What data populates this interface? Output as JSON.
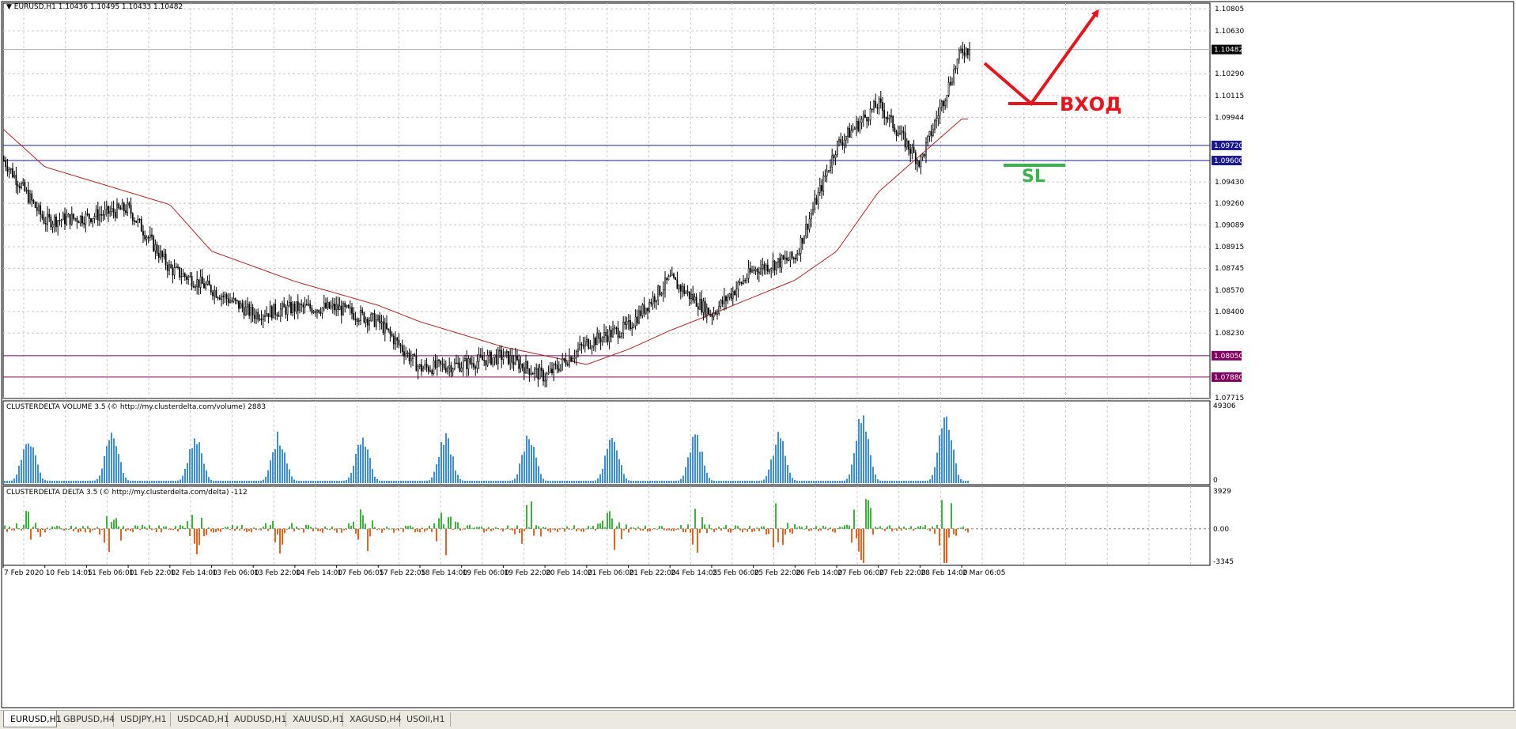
{
  "chart_header": {
    "caret": "▼",
    "title": "EURUSD,H1  1.10436 1.10495 1.10433 1.10482"
  },
  "indicators": {
    "volume_title": "CLUSTERDELTA VOLUME 3.5 (© http://my.clusterdelta.com/volume) 2883",
    "volume_axis": [
      "49306",
      "0"
    ],
    "delta_title": "CLUSTERDELTA DELTA 3.5 (© http://my.clusterdelta.com/delta) -112",
    "delta_axis": [
      "3929",
      "0.00",
      "-3345"
    ]
  },
  "price_axis": [
    "1.10805",
    "1.10630",
    "1.10290",
    "1.10115",
    "1.09944",
    "1.09430",
    "1.09260",
    "1.09089",
    "1.08915",
    "1.08745",
    "1.08570",
    "1.08400",
    "1.08230",
    "1.07715"
  ],
  "price_flags": [
    {
      "text": "1.10482",
      "color": "#000000"
    },
    {
      "text": "1.09720",
      "color": "#1a1a8c"
    },
    {
      "text": "1.09600",
      "color": "#1a1a8c"
    },
    {
      "text": "1.08050",
      "color": "#800060"
    },
    {
      "text": "1.07880",
      "color": "#800060"
    }
  ],
  "time_axis": [
    "7 Feb 2020",
    "10 Feb 14:05",
    "11 Feb 06:00",
    "11 Feb 22:00",
    "12 Feb 14:00",
    "13 Feb 06:00",
    "13 Feb 22:00",
    "14 Feb 14:00",
    "17 Feb 06:05",
    "17 Feb 22:05",
    "18 Feb 14:00",
    "19 Feb 06:00",
    "19 Feb 22:00",
    "20 Feb 14:00",
    "21 Feb 06:00",
    "21 Feb 22:00",
    "24 Feb 14:05",
    "25 Feb 06:00",
    "25 Feb 22:00",
    "26 Feb 14:00",
    "27 Feb 06:00",
    "27 Feb 22:00",
    "28 Feb 14:00",
    "2 Mar 06:05"
  ],
  "annotations": {
    "entry": "ВХОД",
    "stop_loss": "SL",
    "entry_color": "#e8141c",
    "sl_color": "#3ab34a"
  },
  "tabs": [
    {
      "label": "EURUSD,H1",
      "active": true
    },
    {
      "label": "GBPUSD,H4",
      "active": false
    },
    {
      "label": "USDJPY,H1",
      "active": false
    },
    {
      "label": "USDCAD,H1",
      "active": false
    },
    {
      "label": "AUDUSD,H1",
      "active": false
    },
    {
      "label": "XAUUSD,H1",
      "active": false
    },
    {
      "label": "XAGUSD,H4",
      "active": false
    },
    {
      "label": "USOil,H1",
      "active": false
    }
  ],
  "colors": {
    "candle": "#000000",
    "moving_average": "#b22222",
    "volume_bar": "#3a8fd8",
    "delta_positive": "#3cb43c",
    "delta_negative": "#e8641e",
    "level_blue": "#1a1a8c",
    "level_purple": "#800060"
  },
  "chart_data": {
    "type": "candlestick",
    "symbol": "EURUSD",
    "timeframe": "H1",
    "ylim": [
      1.0771,
      1.1085
    ],
    "last": {
      "open": 1.10436,
      "high": 1.10495,
      "low": 1.10433,
      "close": 1.10482
    },
    "levels": [
      1.0972,
      1.096,
      1.0805,
      1.0788
    ],
    "close_path": [
      {
        "x": "7 Feb 2020",
        "y": 1.0949
      },
      {
        "x": "7 Feb 2020",
        "y": 1.0961
      },
      {
        "x": "10 Feb 14:05",
        "y": 1.0912
      },
      {
        "x": "11 Feb 06:00",
        "y": 1.0915
      },
      {
        "x": "11 Feb 22:00",
        "y": 1.0922
      },
      {
        "x": "12 Feb 14:00",
        "y": 1.0874
      },
      {
        "x": "13 Feb 06:00",
        "y": 1.0858
      },
      {
        "x": "13 Feb 22:00",
        "y": 1.0838
      },
      {
        "x": "14 Feb 14:00",
        "y": 1.0843
      },
      {
        "x": "17 Feb 06:05",
        "y": 1.0843
      },
      {
        "x": "17 Feb 22:05",
        "y": 1.0832
      },
      {
        "x": "18 Feb 14:00",
        "y": 1.0795
      },
      {
        "x": "19 Feb 06:00",
        "y": 1.0798
      },
      {
        "x": "19 Feb 22:00",
        "y": 1.0805
      },
      {
        "x": "20 Feb 14:00",
        "y": 1.0788
      },
      {
        "x": "21 Feb 06:00",
        "y": 1.0815
      },
      {
        "x": "21 Feb 22:00",
        "y": 1.0828
      },
      {
        "x": "24 Feb 14:05",
        "y": 1.0866
      },
      {
        "x": "25 Feb 06:00",
        "y": 1.0838
      },
      {
        "x": "25 Feb 22:00",
        "y": 1.0873
      },
      {
        "x": "26 Feb 14:00",
        "y": 1.0883
      },
      {
        "x": "27 Feb 06:00",
        "y": 1.0972
      },
      {
        "x": "27 Feb 22:00",
        "y": 1.1005
      },
      {
        "x": "28 Feb 14:00",
        "y": 1.0958
      },
      {
        "x": "2 Mar 06:05",
        "y": 1.1048
      }
    ],
    "moving_average_path": [
      {
        "x": "7 Feb 2020",
        "y": 1.0985
      },
      {
        "x": "10 Feb 14:05",
        "y": 1.0955
      },
      {
        "x": "11 Feb 22:00",
        "y": 1.0935
      },
      {
        "x": "12 Feb 14:00",
        "y": 1.0925
      },
      {
        "x": "13 Feb 06:00",
        "y": 1.0888
      },
      {
        "x": "14 Feb 14:00",
        "y": 1.0864
      },
      {
        "x": "17 Feb 22:05",
        "y": 1.0845
      },
      {
        "x": "18 Feb 14:00",
        "y": 1.0832
      },
      {
        "x": "19 Feb 22:00",
        "y": 1.0812
      },
      {
        "x": "21 Feb 06:00",
        "y": 1.0798
      },
      {
        "x": "21 Feb 22:00",
        "y": 1.081
      },
      {
        "x": "24 Feb 14:05",
        "y": 1.0825
      },
      {
        "x": "25 Feb 06:00",
        "y": 1.0838
      },
      {
        "x": "26 Feb 14:00",
        "y": 1.0865
      },
      {
        "x": "27 Feb 06:00",
        "y": 1.0888
      },
      {
        "x": "27 Feb 22:00",
        "y": 1.0935
      },
      {
        "x": "2 Mar 06:05",
        "y": 1.0993
      }
    ],
    "volume_range": [
      0,
      49306
    ],
    "delta_range": [
      -3345,
      3929
    ]
  }
}
